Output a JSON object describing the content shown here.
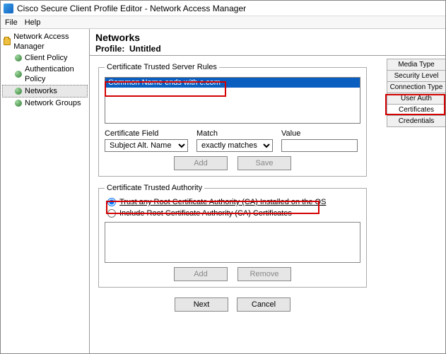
{
  "window": {
    "title": "Cisco Secure Client Profile Editor - Network Access Manager"
  },
  "menu": {
    "file": "File",
    "help": "Help"
  },
  "sidebar": {
    "root": "Network Access Manager",
    "items": [
      "Client Policy",
      "Authentication Policy",
      "Networks",
      "Network Groups"
    ],
    "selected_index": 2
  },
  "header": {
    "title": "Networks",
    "profile_label": "Profile:",
    "profile_name": "Untitled"
  },
  "right_tabs": [
    "Media Type",
    "Security Level",
    "Connection Type",
    "User Auth",
    "Certificates",
    "Credentials"
  ],
  "right_tab_selected": "Certificates",
  "server_rules": {
    "legend": "Certificate Trusted Server Rules",
    "selected_rule": "Common Name ends with c.com",
    "cert_field_label": "Certificate Field",
    "cert_field_value": "Subject Alt. Name",
    "cert_field_options": [
      "Subject Alt. Name"
    ],
    "match_label": "Match",
    "match_value": "exactly matches",
    "match_options": [
      "exactly matches"
    ],
    "value_label": "Value",
    "value_value": "",
    "add_label": "Add",
    "save_label": "Save"
  },
  "authority": {
    "legend": "Certificate Trusted Authority",
    "opt_any_label": "Trust any Root Certificate Authority (CA) Installed on the OS",
    "opt_include_label": "Include Root Certificate Authority (CA) Certificates",
    "selected": "any",
    "add_label": "Add",
    "remove_label": "Remove"
  },
  "footer": {
    "next": "Next",
    "cancel": "Cancel"
  }
}
